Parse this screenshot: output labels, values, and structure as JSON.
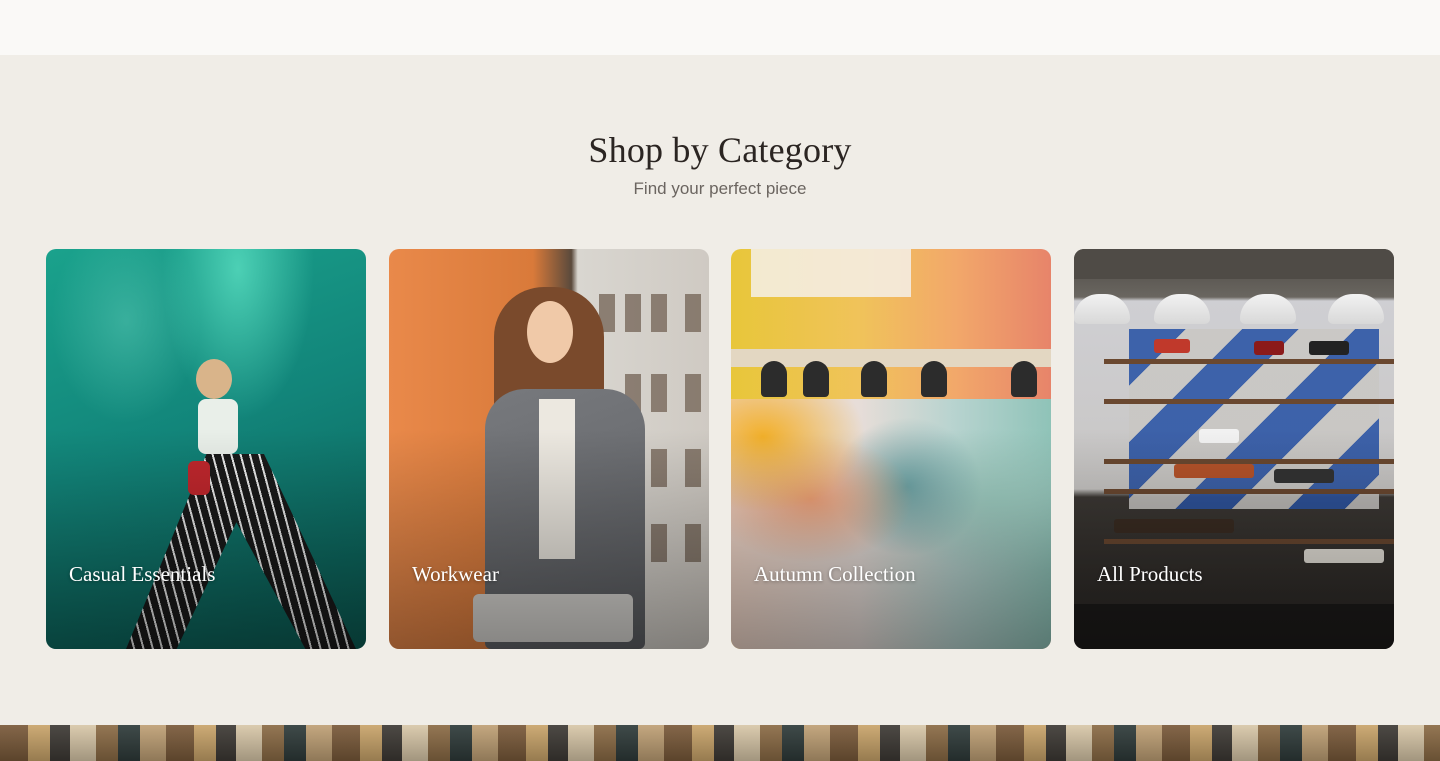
{
  "section": {
    "title": "Shop by Category",
    "subtitle": "Find your perfect piece"
  },
  "categories": [
    {
      "label": "Casual Essentials",
      "image": "woman-posing-teal-wall"
    },
    {
      "label": "Workwear",
      "image": "woman-in-blazer-orange-wall"
    },
    {
      "label": "Autumn Collection",
      "image": "clothes-on-rack"
    },
    {
      "label": "All Products",
      "image": "store-shelves-interior"
    }
  ]
}
